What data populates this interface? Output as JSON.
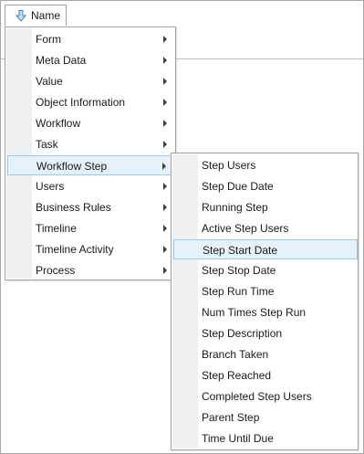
{
  "header": {
    "name_label": "Name"
  },
  "main_menu": {
    "items": [
      {
        "label": "Form"
      },
      {
        "label": "Meta Data"
      },
      {
        "label": "Value"
      },
      {
        "label": "Object Information"
      },
      {
        "label": "Workflow"
      },
      {
        "label": "Task"
      },
      {
        "label": "Workflow Step"
      },
      {
        "label": "Users"
      },
      {
        "label": "Business Rules"
      },
      {
        "label": "Timeline"
      },
      {
        "label": "Timeline Activity"
      },
      {
        "label": "Process"
      }
    ],
    "selected_index": 6
  },
  "submenu": {
    "items": [
      {
        "label": "Step Users"
      },
      {
        "label": "Step Due Date"
      },
      {
        "label": "Running Step"
      },
      {
        "label": "Active Step Users"
      },
      {
        "label": "Step Start Date"
      },
      {
        "label": "Step Stop Date"
      },
      {
        "label": "Step Run Time"
      },
      {
        "label": "Num Times Step Run"
      },
      {
        "label": "Step Description"
      },
      {
        "label": "Branch Taken"
      },
      {
        "label": "Step Reached"
      },
      {
        "label": "Completed Step Users"
      },
      {
        "label": "Parent Step"
      },
      {
        "label": "Time Until Due"
      }
    ],
    "hovered_index": 4
  },
  "colors": {
    "highlight_bg": "#e5f1fb",
    "highlight_border": "#99c9ef",
    "gutter": "#f0f0f0",
    "sort_arrow": "#4a7fc1"
  },
  "icons": {
    "sort": "sort-down-arrow-icon",
    "submenu": "chevron-right-icon"
  }
}
